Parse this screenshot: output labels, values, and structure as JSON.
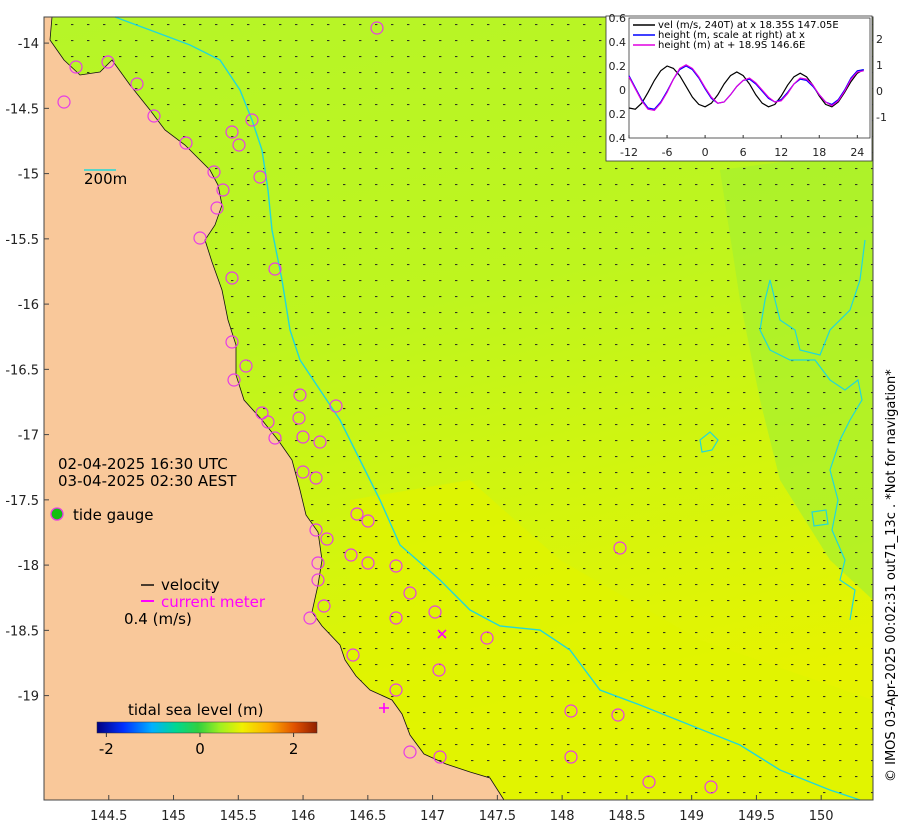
{
  "map": {
    "datetime_utc": "02-04-2025 16:30 UTC",
    "datetime_aest": "03-04-2025 02:30 AEST",
    "contour_label": "200m",
    "legend": {
      "tide_gauge": "tide gauge",
      "velocity": "velocity",
      "current_meter": "current meter",
      "scale": "0.4 (m/s)"
    },
    "colorbar": {
      "title": "tidal sea level (m)",
      "ticks": [
        "-2",
        "0",
        "2"
      ],
      "range": [
        -2.2,
        2.5
      ]
    },
    "credit": "© IMOS 03-Apr-2025 00:02:31 out71_13c . *Not for navigation*",
    "x_axis": {
      "range": [
        144.0,
        150.4
      ],
      "ticks": [
        144.5,
        145,
        145.5,
        146,
        146.5,
        147,
        147.5,
        148,
        148.5,
        149,
        149.5,
        150
      ]
    },
    "y_axis": {
      "range": [
        -19.8,
        -13.8
      ],
      "ticks": [
        -14,
        -14.5,
        -15,
        -15.5,
        -16,
        -16.5,
        -17,
        -17.5,
        -18,
        -18.5,
        -19
      ]
    },
    "colors": {
      "land": "#f9c89a",
      "sea_north": "#b6f528",
      "sea_mid": "#c8f514",
      "sea_south": "#e3f500",
      "contour": "#22d8d8",
      "gauge_ring": "#e63ce6",
      "current_meter": "#ff00ff"
    }
  },
  "inset": {
    "legend": [
      {
        "label": "vel (m/s, 240T) at x 18.35S 147.05E",
        "color": "#000000"
      },
      {
        "label": "height (m, scale at right) at x",
        "color": "#0000ff"
      },
      {
        "label": "height (m) at + 18.9S 146.6E",
        "color": "#e000e0"
      }
    ],
    "x_ticks": [
      "-12",
      "-6",
      "0",
      "6",
      "12",
      "18",
      "24"
    ],
    "left_ticks": [
      "0.6",
      "0.4",
      "0.2",
      "0",
      "0.2",
      "0.4"
    ],
    "right_ticks": [
      "2",
      "1",
      "0",
      "-1"
    ],
    "x_range": [
      -12,
      26
    ],
    "left_range": [
      -0.4,
      0.6
    ],
    "right_range": [
      -1.8,
      2.8
    ],
    "series": [
      {
        "name": "vel",
        "color": "#000000",
        "x": [
          -12,
          -11,
          -10,
          -9,
          -8,
          -7,
          -6,
          -5,
          -4,
          -3,
          -2,
          -1,
          0,
          1,
          2,
          3,
          4,
          5,
          6,
          7,
          8,
          9,
          10,
          11,
          12,
          13,
          14,
          15,
          16,
          17,
          18,
          19,
          20,
          21,
          22,
          23,
          24,
          25
        ],
        "y": [
          -0.15,
          -0.16,
          -0.11,
          -0.02,
          0.08,
          0.16,
          0.2,
          0.18,
          0.12,
          0.03,
          -0.06,
          -0.12,
          -0.14,
          -0.11,
          -0.04,
          0.05,
          0.12,
          0.15,
          0.12,
          0.05,
          -0.04,
          -0.11,
          -0.14,
          -0.12,
          -0.05,
          0.04,
          0.11,
          0.14,
          0.11,
          0.04,
          -0.05,
          -0.12,
          -0.14,
          -0.1,
          -0.02,
          0.07,
          0.14,
          0.17
        ]
      },
      {
        "name": "height x",
        "color": "#0000ff",
        "x": [
          -12,
          -11,
          -10,
          -9,
          -8,
          -7,
          -6,
          -5,
          -4,
          -3,
          -2,
          -1,
          0,
          1,
          2,
          3,
          4,
          5,
          6,
          7,
          8,
          9,
          10,
          11,
          12,
          13,
          14,
          15,
          16,
          17,
          18,
          19,
          20,
          21,
          22,
          23,
          24,
          25
        ],
        "y": [
          0.12,
          0.02,
          -0.08,
          -0.15,
          -0.16,
          -0.1,
          -0.01,
          0.09,
          0.17,
          0.2,
          0.17,
          0.1,
          0.01,
          -0.07,
          -0.11,
          -0.1,
          -0.04,
          0.03,
          0.08,
          0.09,
          0.05,
          -0.01,
          -0.07,
          -0.1,
          -0.08,
          -0.02,
          0.05,
          0.09,
          0.08,
          0.03,
          -0.04,
          -0.1,
          -0.12,
          -0.08,
          0.0,
          0.1,
          0.16,
          0.17
        ]
      },
      {
        "name": "height +",
        "color": "#e000e0",
        "x": [
          -12,
          -11,
          -10,
          -9,
          -8,
          -7,
          -6,
          -5,
          -4,
          -3,
          -2,
          -1,
          0,
          1,
          2,
          3,
          4,
          5,
          6,
          7,
          8,
          9,
          10,
          11,
          12,
          13,
          14,
          15,
          16,
          17,
          18,
          19,
          20,
          21,
          22,
          23,
          24,
          25
        ],
        "y": [
          0.11,
          0.01,
          -0.09,
          -0.16,
          -0.17,
          -0.11,
          -0.02,
          0.09,
          0.18,
          0.21,
          0.18,
          0.11,
          0.02,
          -0.06,
          -0.11,
          -0.1,
          -0.04,
          0.03,
          0.08,
          0.1,
          0.06,
          0.0,
          -0.06,
          -0.1,
          -0.09,
          -0.03,
          0.05,
          0.1,
          0.09,
          0.04,
          -0.04,
          -0.1,
          -0.13,
          -0.09,
          -0.01,
          0.09,
          0.15,
          0.16
        ]
      }
    ]
  }
}
